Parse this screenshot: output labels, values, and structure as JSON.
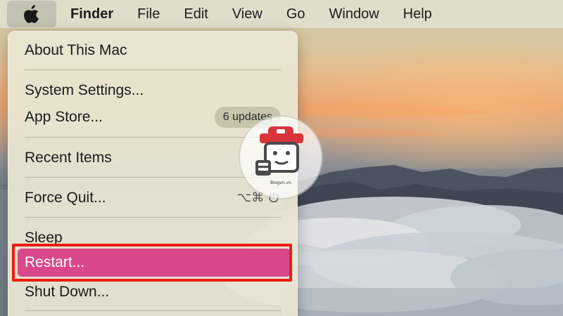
{
  "menubar": {
    "apple_icon": "apple-logo-icon",
    "items": [
      {
        "label": "Finder"
      },
      {
        "label": "File"
      },
      {
        "label": "Edit"
      },
      {
        "label": "View"
      },
      {
        "label": "Go"
      },
      {
        "label": "Window"
      },
      {
        "label": "Help"
      }
    ]
  },
  "apple_menu": {
    "about": "About This Mac",
    "system_settings": "System Settings...",
    "app_store": "App Store...",
    "app_store_badge": "6 updates",
    "recent_items": "Recent Items",
    "force_quit": "Force Quit...",
    "force_quit_shortcut": "⌥⌘",
    "sleep": "Sleep",
    "restart": "Restart...",
    "shut_down": "Shut Down..."
  },
  "colors": {
    "selection": "#d9488a",
    "highlight_box": "#ec1c12"
  },
  "watermark": {
    "text": "Blogvn.vn",
    "icon": "mascot-logo-icon"
  }
}
